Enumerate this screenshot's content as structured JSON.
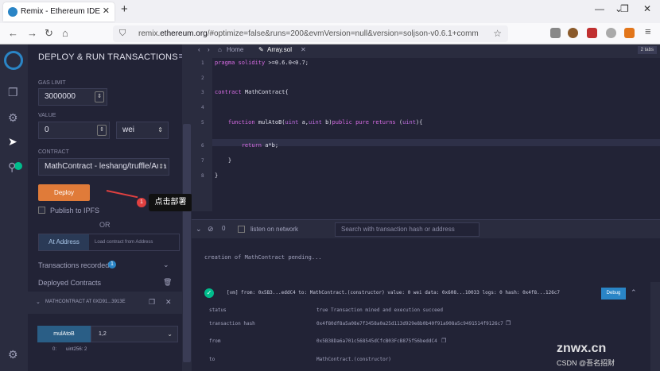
{
  "browser": {
    "tab_title": "Remix - Ethereum IDE",
    "url_prefix": "remix.",
    "url_host": "ethereum.org",
    "url_rest": "/#optimize=false&runs=200&evmVersion=null&version=soljson-v0.6.1+comm"
  },
  "panel": {
    "title": "DEPLOY & RUN TRANSACTIONS",
    "gas_limit_label": "GAS LIMIT",
    "gas_limit_value": "3000000",
    "value_label": "VALUE",
    "value_value": "0",
    "value_unit": "wei",
    "contract_label": "CONTRACT",
    "contract_value": "MathContract - leshang/truffle/Arra",
    "deploy_label": "Deploy",
    "publish_label": "Publish to IPFS",
    "or_label": "OR",
    "at_address_label": "At Address",
    "load_contract_label": "Load contract from Address",
    "tx_recorded_label": "Transactions recorded",
    "tx_recorded_count": "1",
    "deployed_label": "Deployed Contracts",
    "instance_label": "MATHCONTRACT AT 0XD91...3913E",
    "fn_button_label": "mulAtoB",
    "fn_input_value": "1,2",
    "result_index": "0:",
    "result_value": "uint256: 2"
  },
  "editor": {
    "tab_home": "Home",
    "tab_file": "Array.sol",
    "tabs_badge": "2 tabs",
    "lines": [
      "1",
      "2",
      "3",
      "4",
      "5",
      "6",
      "7",
      "8"
    ],
    "code": [
      "pragma solidity >=0.6.0<0.7;",
      "",
      "contract MathContract{",
      "",
      "    function mulAtoB(uint a,uint b)public pure returns (uint){",
      "        return a*b;",
      "    }",
      "}"
    ]
  },
  "annotation": {
    "badge": "1",
    "text": "点击部署"
  },
  "terminal": {
    "count": "0",
    "listen_label": "listen on network",
    "search_placeholder": "Search with transaction hash or address",
    "pending_line": "creation of MathContract pending...",
    "tx_summary": "[vm]  from: 0x5B3...eddC4 to: MathContract.(constructor) value: 0 wei data: 0x608...10033 logs: 0 hash: 0x4f8...126c7",
    "debug_label": "Debug",
    "rows": [
      {
        "key": "status",
        "value": "true Transaction mined and execution succeed"
      },
      {
        "key": "transaction hash",
        "value": "0x4f80df8a5a08e7f3458a0a25d113d929e8b0b40f91a908a5c9491514f9126c7"
      },
      {
        "key": "from",
        "value": "0x5B38Da6a701c568545dCfcB03FcB875f56beddC4"
      },
      {
        "key": "to",
        "value": "MathContract.(constructor)"
      }
    ]
  },
  "watermark": {
    "site": "znwx.cn",
    "credit": "CSDN @吾名招财"
  },
  "colors": {
    "accent": "#2a85c6",
    "deploy": "#e07b39",
    "success": "#00bc8c",
    "annotation": "#e04040"
  }
}
